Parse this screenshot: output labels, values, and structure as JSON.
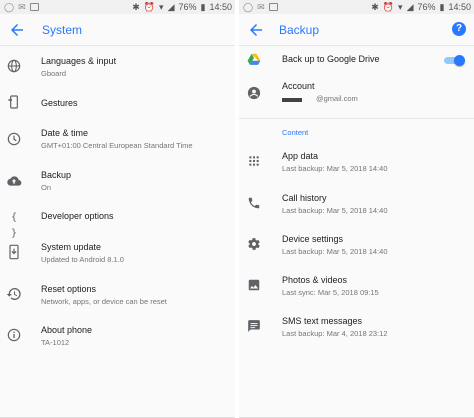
{
  "status": {
    "battery": "76%",
    "time": "14:50"
  },
  "left": {
    "title": "System",
    "items": [
      {
        "title": "Languages & input",
        "sub": "Gboard",
        "icon": "globe-icon"
      },
      {
        "title": "Gestures",
        "sub": "",
        "icon": "gestures-icon"
      },
      {
        "title": "Date & time",
        "sub": "GMT+01:00 Central European Standard Time",
        "icon": "clock-icon"
      },
      {
        "title": "Backup",
        "sub": "On",
        "icon": "cloud-upload-icon"
      },
      {
        "title": "Developer options",
        "sub": "",
        "icon": "code-braces-icon"
      },
      {
        "title": "System update",
        "sub": "Updated to Android 8.1.0",
        "icon": "system-update-icon"
      },
      {
        "title": "Reset options",
        "sub": "Network, apps, or device can be reset",
        "icon": "history-icon"
      },
      {
        "title": "About phone",
        "sub": "TA-1012",
        "icon": "info-icon"
      }
    ]
  },
  "right": {
    "title": "Backup",
    "drive": {
      "title": "Back up to Google Drive",
      "enabled": true
    },
    "account": {
      "title": "Account",
      "sub": "@gmail.com"
    },
    "section": "Content",
    "items": [
      {
        "title": "App data",
        "sub": "Last backup: Mar 5, 2018 14:40",
        "icon": "apps-grid-icon"
      },
      {
        "title": "Call history",
        "sub": "Last backup: Mar 5, 2018 14:40",
        "icon": "phone-icon"
      },
      {
        "title": "Device settings",
        "sub": "Last backup: Mar 5, 2018 14:40",
        "icon": "gear-icon"
      },
      {
        "title": "Photos & videos",
        "sub": "Last sync: Mar 5, 2018 09:15",
        "icon": "photo-icon"
      },
      {
        "title": "SMS text messages",
        "sub": "Last backup: Mar 4, 2018 23:12",
        "icon": "message-icon"
      }
    ]
  },
  "colors": {
    "accent": "#2979ff",
    "icon": "#5f6368",
    "drive_yellow": "#fbbc04",
    "drive_green": "#34a853",
    "drive_blue": "#4285f4"
  }
}
